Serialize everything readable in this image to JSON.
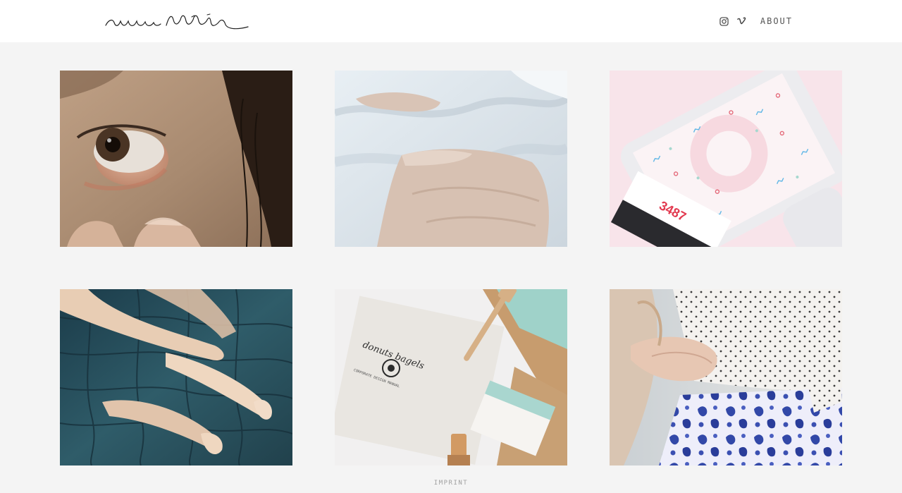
{
  "header": {
    "logo_alt": "ana tellig",
    "nav": {
      "instagram_icon": "instagram-icon",
      "vimeo_icon": "vimeo-icon",
      "about_label": "ABOUT"
    }
  },
  "projects": [
    {
      "image": "close-up of eye being touched"
    },
    {
      "image": "hand on white fabric"
    },
    {
      "image": "phone app with counter",
      "counter": "3487"
    },
    {
      "image": "legs underwater in pool"
    },
    {
      "image": "bagels brand stationery",
      "brand": "donuts bagels",
      "caption": "CORPORATE DESIGN MANUAL"
    },
    {
      "image": "hands and floral skirt"
    }
  ],
  "footer": {
    "imprint_label": "IMPRINT"
  }
}
